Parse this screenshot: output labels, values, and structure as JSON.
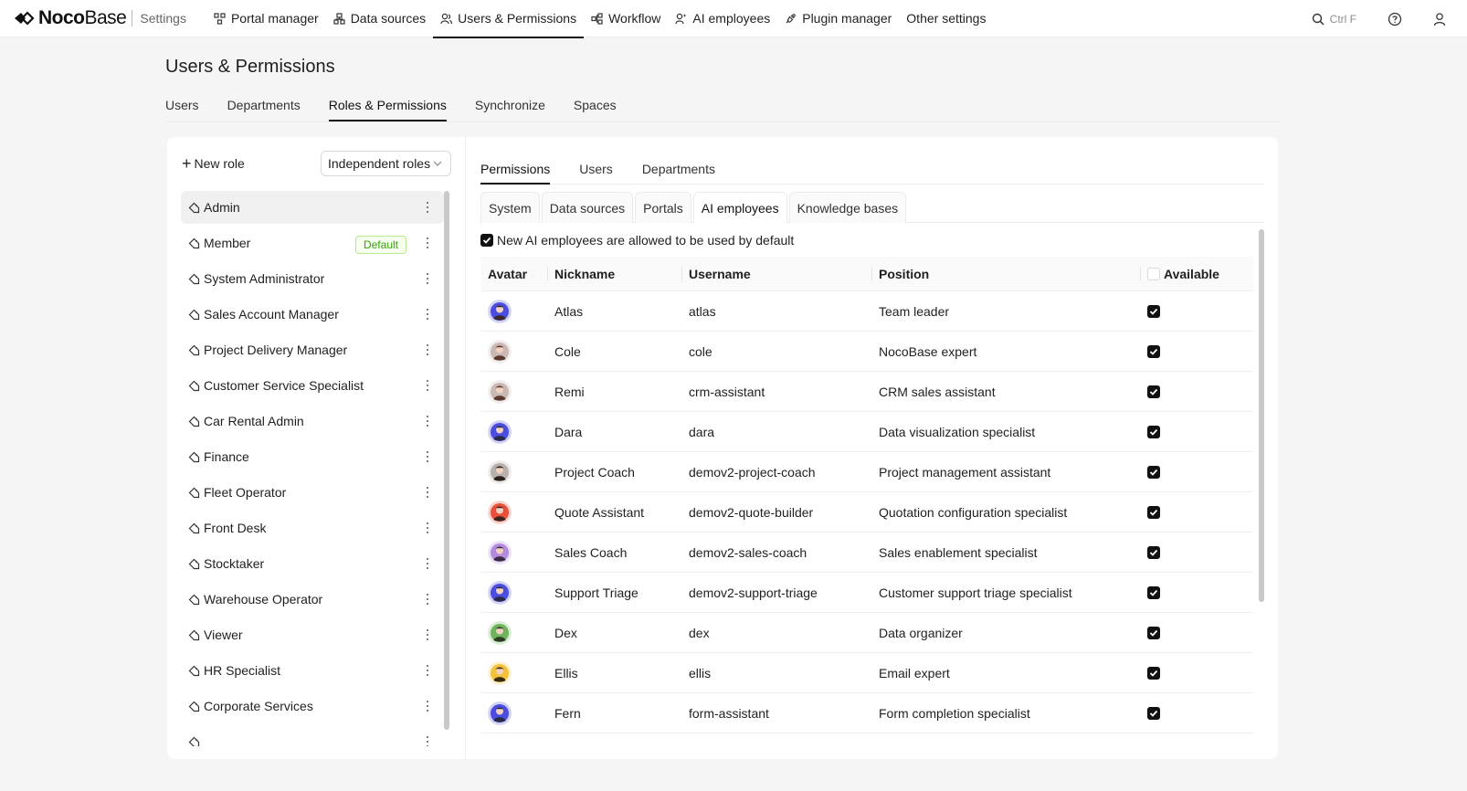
{
  "app": {
    "logo_bold": "Noco",
    "logo_light": "Base",
    "section": "Settings"
  },
  "nav": [
    {
      "label": "Portal manager",
      "icon": "portal-icon",
      "active": false
    },
    {
      "label": "Data sources",
      "icon": "database-icon",
      "active": false
    },
    {
      "label": "Users & Permissions",
      "icon": "users-icon",
      "active": true
    },
    {
      "label": "Workflow",
      "icon": "workflow-icon",
      "active": false
    },
    {
      "label": "AI employees",
      "icon": "ai-employees-icon",
      "active": false
    },
    {
      "label": "Plugin manager",
      "icon": "plugin-icon",
      "active": false
    },
    {
      "label": "Other settings",
      "icon": "",
      "active": false
    }
  ],
  "search": {
    "shortcut": "Ctrl F"
  },
  "page": {
    "title": "Users & Permissions",
    "tabs": [
      "Users",
      "Departments",
      "Roles & Permissions",
      "Synchronize",
      "Spaces"
    ],
    "active_tab": "Roles & Permissions"
  },
  "roles": {
    "new_role_label": "New role",
    "mode_select": "Independent roles",
    "items": [
      {
        "name": "Admin",
        "active": true,
        "badge": ""
      },
      {
        "name": "Member",
        "active": false,
        "badge": "Default"
      },
      {
        "name": "System Administrator",
        "active": false,
        "badge": ""
      },
      {
        "name": "Sales Account Manager",
        "active": false,
        "badge": ""
      },
      {
        "name": "Project Delivery Manager",
        "active": false,
        "badge": ""
      },
      {
        "name": "Customer Service Specialist",
        "active": false,
        "badge": ""
      },
      {
        "name": "Car Rental Admin",
        "active": false,
        "badge": ""
      },
      {
        "name": "Finance",
        "active": false,
        "badge": ""
      },
      {
        "name": "Fleet Operator",
        "active": false,
        "badge": ""
      },
      {
        "name": "Front Desk",
        "active": false,
        "badge": ""
      },
      {
        "name": "Stocktaker",
        "active": false,
        "badge": ""
      },
      {
        "name": "Warehouse Operator",
        "active": false,
        "badge": ""
      },
      {
        "name": "Viewer",
        "active": false,
        "badge": ""
      },
      {
        "name": "HR Specialist",
        "active": false,
        "badge": ""
      },
      {
        "name": "Corporate Services",
        "active": false,
        "badge": ""
      },
      {
        "name": "",
        "active": false,
        "badge": ""
      }
    ]
  },
  "permissions": {
    "tabs": [
      "Permissions",
      "Users",
      "Departments"
    ],
    "active_tab": "Permissions",
    "sub_tabs": [
      "System",
      "Data sources",
      "Portals",
      "AI employees",
      "Knowledge bases"
    ],
    "active_sub_tab": "AI employees",
    "allow_default": {
      "label": "New AI employees are allowed to be used by default",
      "checked": true
    },
    "table": {
      "columns": [
        "Avatar",
        "Nickname",
        "Username",
        "Position",
        "Available"
      ],
      "available_header_checked": false,
      "rows": [
        {
          "nickname": "Atlas",
          "username": "atlas",
          "position": "Team leader",
          "available": true,
          "avatar_color": "#4b4ce0",
          "skin": "#3a2a2a"
        },
        {
          "nickname": "Cole",
          "username": "cole",
          "position": "NocoBase expert",
          "available": true,
          "avatar_color": "#c9b8b4",
          "skin": "#5a3a2e"
        },
        {
          "nickname": "Remi",
          "username": "crm-assistant",
          "position": "CRM sales assistant",
          "available": true,
          "avatar_color": "#c9b8b4",
          "skin": "#5a3a2e"
        },
        {
          "nickname": "Dara",
          "username": "dara",
          "position": "Data visualization specialist",
          "available": true,
          "avatar_color": "#4b4ce0",
          "skin": "#2a2a44"
        },
        {
          "nickname": "Project Coach",
          "username": "demov2-project-coach",
          "position": "Project management assistant",
          "available": true,
          "avatar_color": "#b8b0ad",
          "skin": "#2b1f1c"
        },
        {
          "nickname": "Quote Assistant",
          "username": "demov2-quote-builder",
          "position": "Quotation configuration specialist",
          "available": true,
          "avatar_color": "#e8503a",
          "skin": "#3a2420"
        },
        {
          "nickname": "Sales Coach",
          "username": "demov2-sales-coach",
          "position": "Sales enablement specialist",
          "available": true,
          "avatar_color": "#b58be0",
          "skin": "#3a2a44"
        },
        {
          "nickname": "Support Triage",
          "username": "demov2-support-triage",
          "position": "Customer support triage specialist",
          "available": true,
          "avatar_color": "#4b4ce0",
          "skin": "#2a2a44"
        },
        {
          "nickname": "Dex",
          "username": "dex",
          "position": "Data organizer",
          "available": true,
          "avatar_color": "#6fb45c",
          "skin": "#2f3a25"
        },
        {
          "nickname": "Ellis",
          "username": "ellis",
          "position": "Email expert",
          "available": true,
          "avatar_color": "#f3c23a",
          "skin": "#3a2a10"
        },
        {
          "nickname": "Fern",
          "username": "form-assistant",
          "position": "Form completion specialist",
          "available": true,
          "avatar_color": "#4b4ce0",
          "skin": "#2a2a44"
        }
      ]
    }
  }
}
